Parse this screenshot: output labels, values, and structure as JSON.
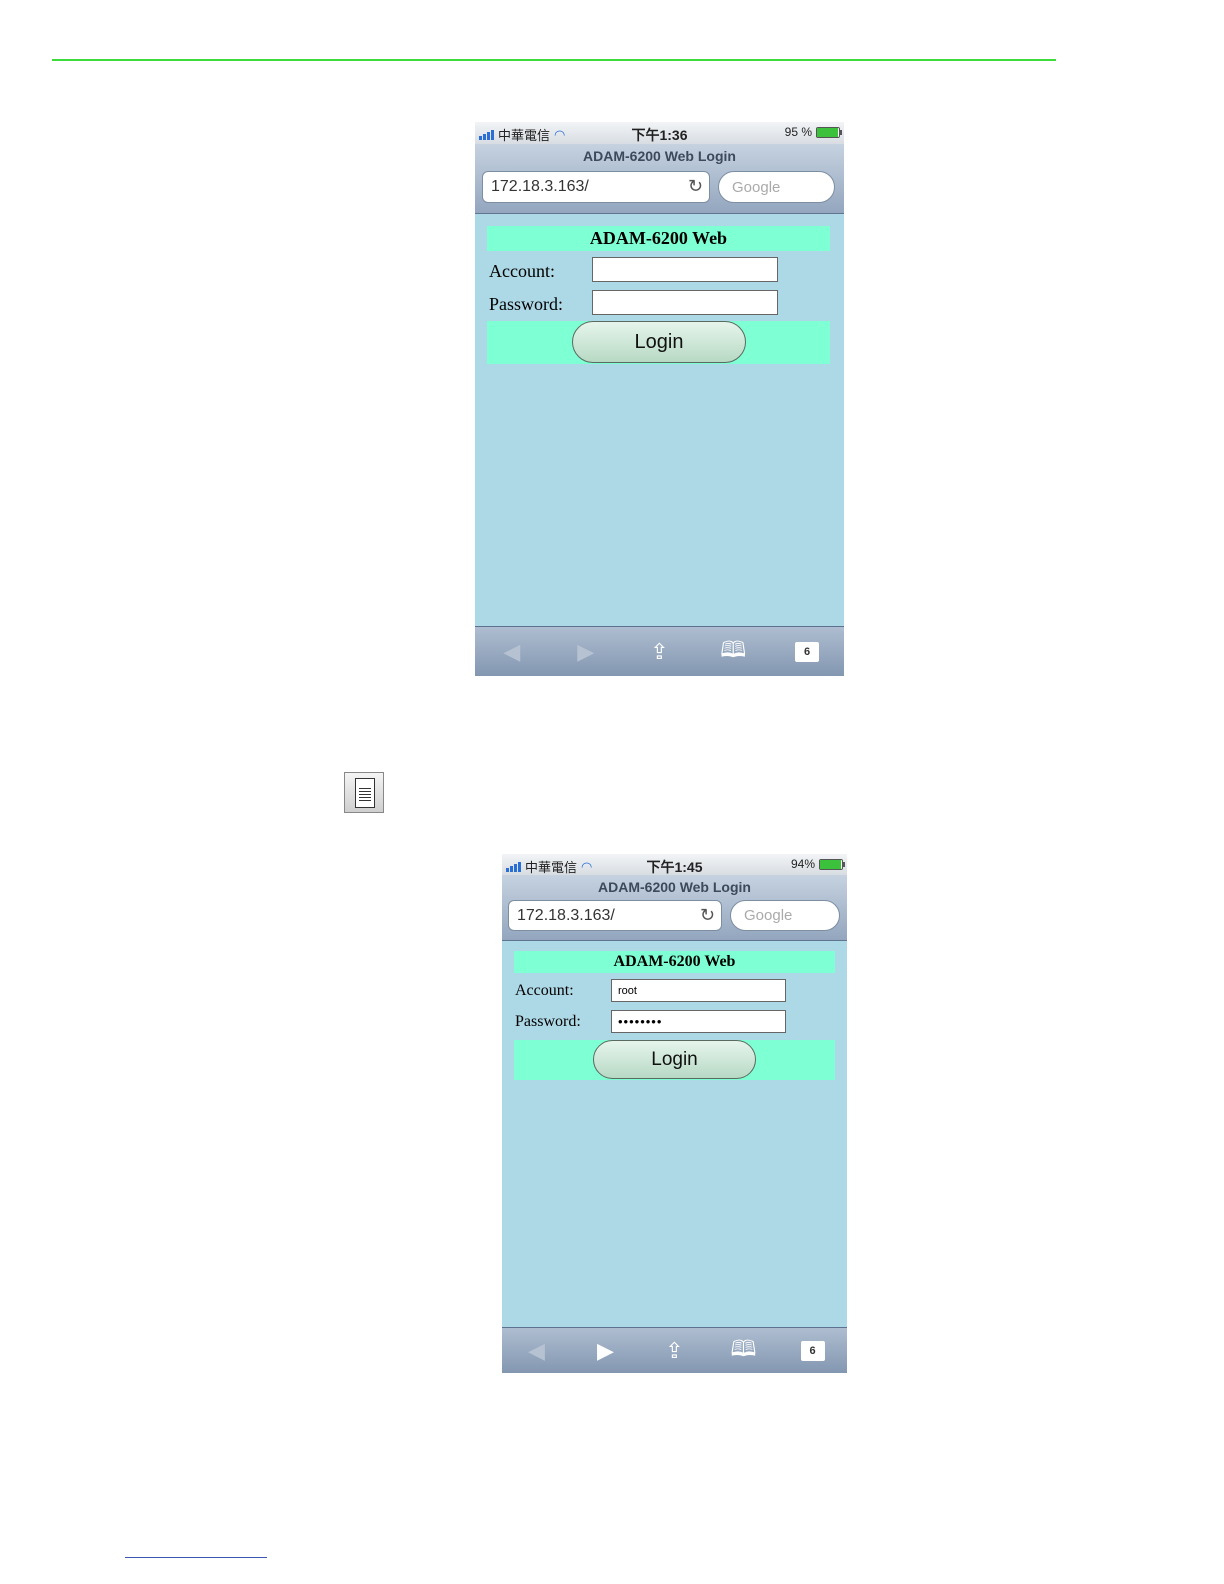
{
  "screens": [
    {
      "status": {
        "carrier": "中華電信",
        "time": "下午1:36",
        "battery": "95 %",
        "battery_level": 0.95
      },
      "browser": {
        "title": "ADAM-6200 Web Login",
        "url": "172.18.3.163/",
        "search_placeholder": "Google"
      },
      "page": {
        "heading": "ADAM-6200 Web",
        "account_label": "Account:",
        "password_label": "Password:",
        "account_value": "",
        "password_value": "",
        "login_label": "Login"
      },
      "toolbar": {
        "tab_count": "6"
      }
    },
    {
      "status": {
        "carrier": "中華電信",
        "time": "下午1:45",
        "battery": "94%",
        "battery_level": 0.94
      },
      "browser": {
        "title": "ADAM-6200 Web Login",
        "url": "172.18.3.163/",
        "search_placeholder": "Google"
      },
      "page": {
        "heading": "ADAM-6200 Web",
        "account_label": "Account:",
        "password_label": "Password:",
        "account_value": "root",
        "password_value": "••••••••",
        "login_label": "Login"
      },
      "toolbar": {
        "tab_count": "6"
      }
    }
  ],
  "colors": {
    "rule": "#3ddc3d",
    "page_bg": "#add8e6",
    "band": "#7fffd4"
  }
}
